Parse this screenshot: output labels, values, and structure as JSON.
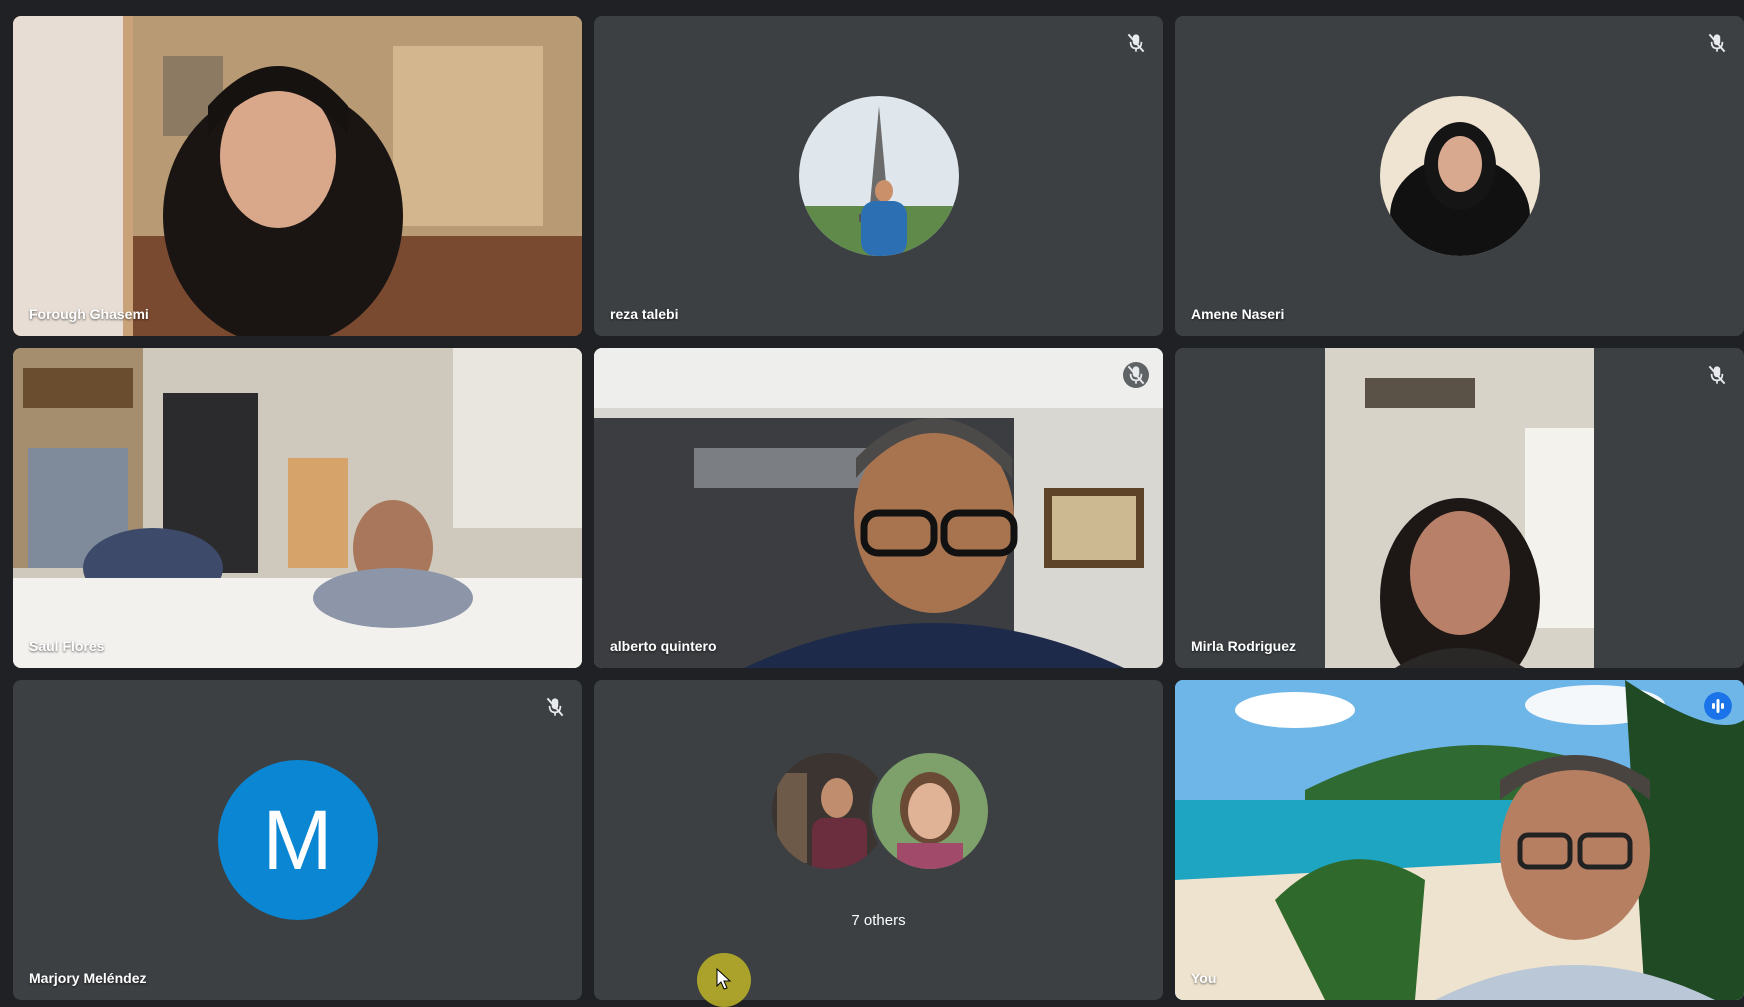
{
  "colors": {
    "tile_bg": "#3c4043",
    "page_bg": "#202124",
    "avatar_m_bg": "#0a86d3",
    "speaking_indicator": "#1a73e8",
    "active_outline": "#8ab4f8"
  },
  "participants": [
    {
      "name": "Forough Ghasemi",
      "type": "video",
      "muted": false
    },
    {
      "name": "reza talebi",
      "type": "photo-avatar",
      "muted": true
    },
    {
      "name": "Amene Naseri",
      "type": "photo-avatar",
      "muted": true
    },
    {
      "name": "Saul Flores",
      "type": "video",
      "muted": false
    },
    {
      "name": "alberto quintero",
      "type": "video",
      "muted": true
    },
    {
      "name": "Mirla Rodriguez",
      "type": "video",
      "muted": true
    },
    {
      "name": "Marjory Meléndez",
      "type": "letter-avatar",
      "letter": "M",
      "muted": true
    },
    {
      "name": "",
      "type": "others"
    },
    {
      "name": "You",
      "type": "video",
      "muted": false,
      "speaking": true
    }
  ],
  "others": {
    "label": "7 others"
  },
  "icons": {
    "muted": "mic-off-icon",
    "speaking": "audio-level-icon",
    "cursor": "mouse-pointer-icon"
  }
}
